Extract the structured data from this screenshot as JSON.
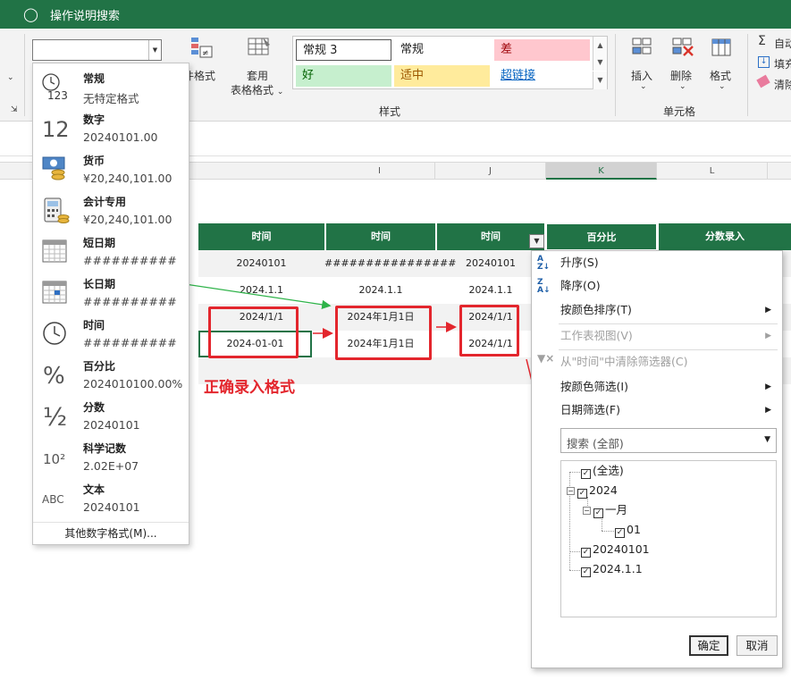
{
  "titlebar": {
    "search_text": "操作说明搜索"
  },
  "ribbon": {
    "cond_format_label": "件格式",
    "table_format_label_1": "套用",
    "table_format_label_2": "表格格式",
    "styles_group_label": "样式",
    "cells_group_label": "单元格",
    "insert_label": "插入",
    "delete_label": "删除",
    "format_label": "格式",
    "autosum_label": "自动",
    "fill_label": "填充",
    "clear_label": "清除",
    "styles": [
      {
        "label": "常规 3",
        "bg": "#ffffff",
        "color": "#222222"
      },
      {
        "label": "常规",
        "bg": "#ffffff",
        "color": "#222222"
      },
      {
        "label": "差",
        "bg": "#ffc7ce",
        "color": "#9c0006"
      },
      {
        "label": "好",
        "bg": "#c6efce",
        "color": "#006100"
      },
      {
        "label": "适中",
        "bg": "#ffeb9c",
        "color": "#9c5700"
      },
      {
        "label": "超链接",
        "bg": "#ffffff",
        "color": "#0563c1"
      }
    ]
  },
  "columns": [
    "I",
    "J",
    "K",
    "L"
  ],
  "table": {
    "headers": [
      "时间",
      "时间",
      "时间",
      "百分比",
      "分数录入"
    ],
    "rows": [
      [
        "20240101",
        "################",
        "20240101"
      ],
      [
        "2024.1.1",
        "2024.1.1",
        "2024.1.1"
      ],
      [
        "2024/1/1",
        "2024年1月1日",
        "2024/1/1"
      ],
      [
        "2024-01-01",
        "2024年1月1日",
        "2024/1/1"
      ]
    ]
  },
  "annotation": "正确录入格式",
  "number_format_menu": {
    "current_value": "",
    "items": [
      {
        "icon": "clock-123-icon",
        "name": "常规",
        "example": "无特定格式"
      },
      {
        "icon": "number-12-icon",
        "name": "数字",
        "example": "20240101.00"
      },
      {
        "icon": "currency-icon",
        "name": "货币",
        "example": "¥20,240,101.00"
      },
      {
        "icon": "calculator-icon",
        "name": "会计专用",
        "example": " ¥20,240,101.00"
      },
      {
        "icon": "calendar-icon",
        "name": "短日期",
        "example": "##########"
      },
      {
        "icon": "calendar-icon",
        "name": "长日期",
        "example": "##########"
      },
      {
        "icon": "clock-icon",
        "name": "时间",
        "example": "##########"
      },
      {
        "icon": "percent-icon",
        "name": "百分比",
        "example": "2024010100.00%"
      },
      {
        "icon": "fraction-icon",
        "name": "分数",
        "example": "20240101"
      },
      {
        "icon": "scientific-icon",
        "name": "科学记数",
        "example": "2.02E+07"
      },
      {
        "icon": "abc-icon",
        "name": "文本",
        "example": "20240101"
      }
    ],
    "more_label": "其他数字格式(M)..."
  },
  "icon_text": {
    "n123": "123",
    "n12": "12",
    "pct": "%",
    "frac": "½",
    "sci": "10²",
    "abc": "ABC"
  },
  "filter_menu": {
    "sort_asc": "升序(S)",
    "sort_desc": "降序(O)",
    "sort_color": "按颜色排序(T)",
    "sheet_view": "工作表视图(V)",
    "clear_filter": "从\"时间\"中清除筛选器(C)",
    "filter_color": "按颜色筛选(I)",
    "date_filter": "日期筛选(F)",
    "search_placeholder": "搜索 (全部)",
    "tree": {
      "select_all": "(全选)",
      "year": "2024",
      "month": "一月",
      "day": "01",
      "other_1": "20240101",
      "other_2": "2024.1.1"
    },
    "ok_label": "确定",
    "cancel_label": "取消"
  },
  "colors": {
    "accent": "#217346",
    "highlight_red": "#e3262d",
    "highlight_green": "#2fb34a"
  }
}
